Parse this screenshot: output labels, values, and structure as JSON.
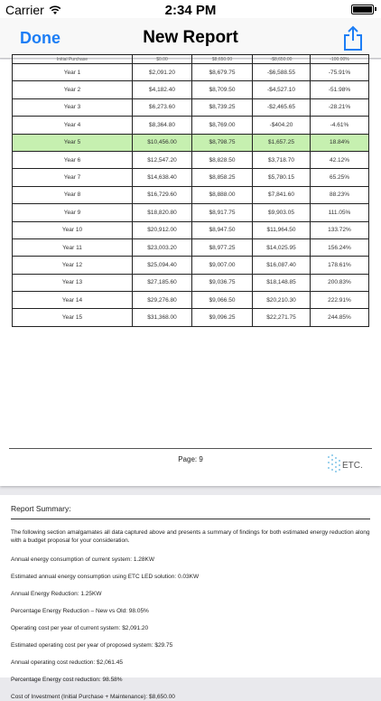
{
  "status_bar": {
    "carrier": "Carrier",
    "time": "2:34 PM"
  },
  "nav": {
    "done_label": "Done",
    "title": "New Report"
  },
  "table": {
    "partial_row": [
      "Initial Purchase",
      "$0.00",
      "$8,650.00",
      "-$8,650.00",
      "-100.00%"
    ],
    "rows": [
      [
        "Year 1",
        "$2,091.20",
        "$8,679.75",
        "-$6,588.55",
        "-75.91%"
      ],
      [
        "Year 2",
        "$4,182.40",
        "$8,709.50",
        "-$4,527.10",
        "-51.98%"
      ],
      [
        "Year 3",
        "$6,273.60",
        "$8,739.25",
        "-$2,465.65",
        "-28.21%"
      ],
      [
        "Year 4",
        "$8,364.80",
        "$8,769.00",
        "-$404.20",
        "-4.61%"
      ],
      [
        "Year 5",
        "$10,456.00",
        "$8,798.75",
        "$1,657.25",
        "18.84%"
      ],
      [
        "Year 6",
        "$12,547.20",
        "$8,828.50",
        "$3,718.70",
        "42.12%"
      ],
      [
        "Year 7",
        "$14,638.40",
        "$8,858.25",
        "$5,780.15",
        "65.25%"
      ],
      [
        "Year 8",
        "$16,729.60",
        "$8,888.00",
        "$7,841.60",
        "88.23%"
      ],
      [
        "Year 9",
        "$18,820.80",
        "$8,917.75",
        "$9,903.05",
        "111.05%"
      ],
      [
        "Year 10",
        "$20,912.00",
        "$8,947.50",
        "$11,964.50",
        "133.72%"
      ],
      [
        "Year 11",
        "$23,003.20",
        "$8,977.25",
        "$14,025.95",
        "156.24%"
      ],
      [
        "Year 12",
        "$25,094.40",
        "$9,007.00",
        "$16,087.40",
        "178.61%"
      ],
      [
        "Year 13",
        "$27,185.60",
        "$9,036.75",
        "$18,148.85",
        "200.83%"
      ],
      [
        "Year 14",
        "$29,276.80",
        "$9,066.50",
        "$20,210.30",
        "222.91%"
      ],
      [
        "Year 15",
        "$31,368.00",
        "$9,096.25",
        "$22,271.75",
        "244.85%"
      ]
    ],
    "highlight_color": "#c6f0b0"
  },
  "page_footer": {
    "page_label": "Page: 9",
    "logo_text": "ETC."
  },
  "summary": {
    "title": "Report Summary:",
    "intro": "The following section amalgamates all data captured above and presents a summary of findings for both estimated energy reduction along with a budget proposal for your consideration.",
    "lines": [
      "Annual energy consumption of current system: 1.28KW",
      "Estimated annual energy consumption using ETC LED solution: 0.03KW",
      "Annual Energy Reduction: 1.25KW",
      "Percentage Energy Reduction – New vs Old: 98.05%",
      "Operating cost per year of current system: $2,091.20",
      "Estimated operating cost per year of proposed system: $29.75",
      "Annual operating cost reduction: $2,061.45",
      "Percentage Energy cost reduction: 98.58%",
      "Cost of Investment (Initial Purchase + Maintenance): $8,650.00"
    ]
  },
  "colors": {
    "accent": "#1d7ef5"
  }
}
